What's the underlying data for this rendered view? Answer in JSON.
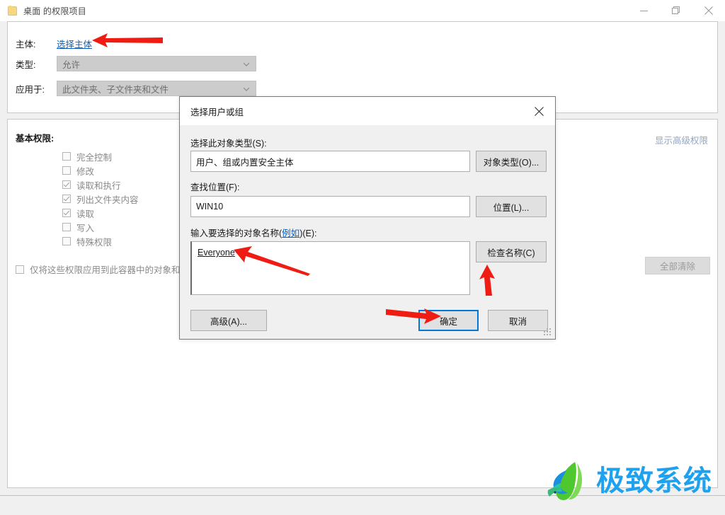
{
  "window": {
    "title": "桌面 的权限项目",
    "icon": "folder-icon",
    "minimize": "–",
    "restore": "❐",
    "close": "✕"
  },
  "form": {
    "principal_label": "主体:",
    "principal_link": "选择主体",
    "type_label": "类型:",
    "type_value": "允许",
    "applies_label": "应用于:",
    "applies_value": "此文件夹、子文件夹和文件"
  },
  "permissions": {
    "section_title": "基本权限:",
    "advanced_link": "显示高级权限",
    "clear_all_button": "全部清除",
    "apply_container_label": "仅将这些权限应用到此容器中的对象和",
    "apply_container_checked": false,
    "items": [
      {
        "label": "完全控制",
        "checked": false
      },
      {
        "label": "修改",
        "checked": false
      },
      {
        "label": "读取和执行",
        "checked": true
      },
      {
        "label": "列出文件夹内容",
        "checked": true
      },
      {
        "label": "读取",
        "checked": true
      },
      {
        "label": "写入",
        "checked": false
      },
      {
        "label": "特殊权限",
        "checked": false
      }
    ]
  },
  "modal": {
    "title": "选择用户或组",
    "close": "✕",
    "object_type_label": "选择此对象类型(S):",
    "object_type_value": "用户、组或内置安全主体",
    "object_type_button": "对象类型(O)...",
    "location_label": "查找位置(F):",
    "location_value": "WIN10",
    "location_button": "位置(L)...",
    "object_name_label_prefix": "输入要选择的对象名称(",
    "object_name_label_link": "例如",
    "object_name_label_suffix": ")(E):",
    "object_name_value": "Everyone",
    "check_names_button": "检查名称(C)",
    "advanced_button": "高级(A)...",
    "ok_button": "确定",
    "cancel_button": "取消"
  },
  "watermark": {
    "text": "极致系统"
  },
  "colors": {
    "accent": "#0078d7",
    "link": "#0b60c4",
    "annotation": "#ee1c12",
    "watermark": "#1ea2f0"
  }
}
